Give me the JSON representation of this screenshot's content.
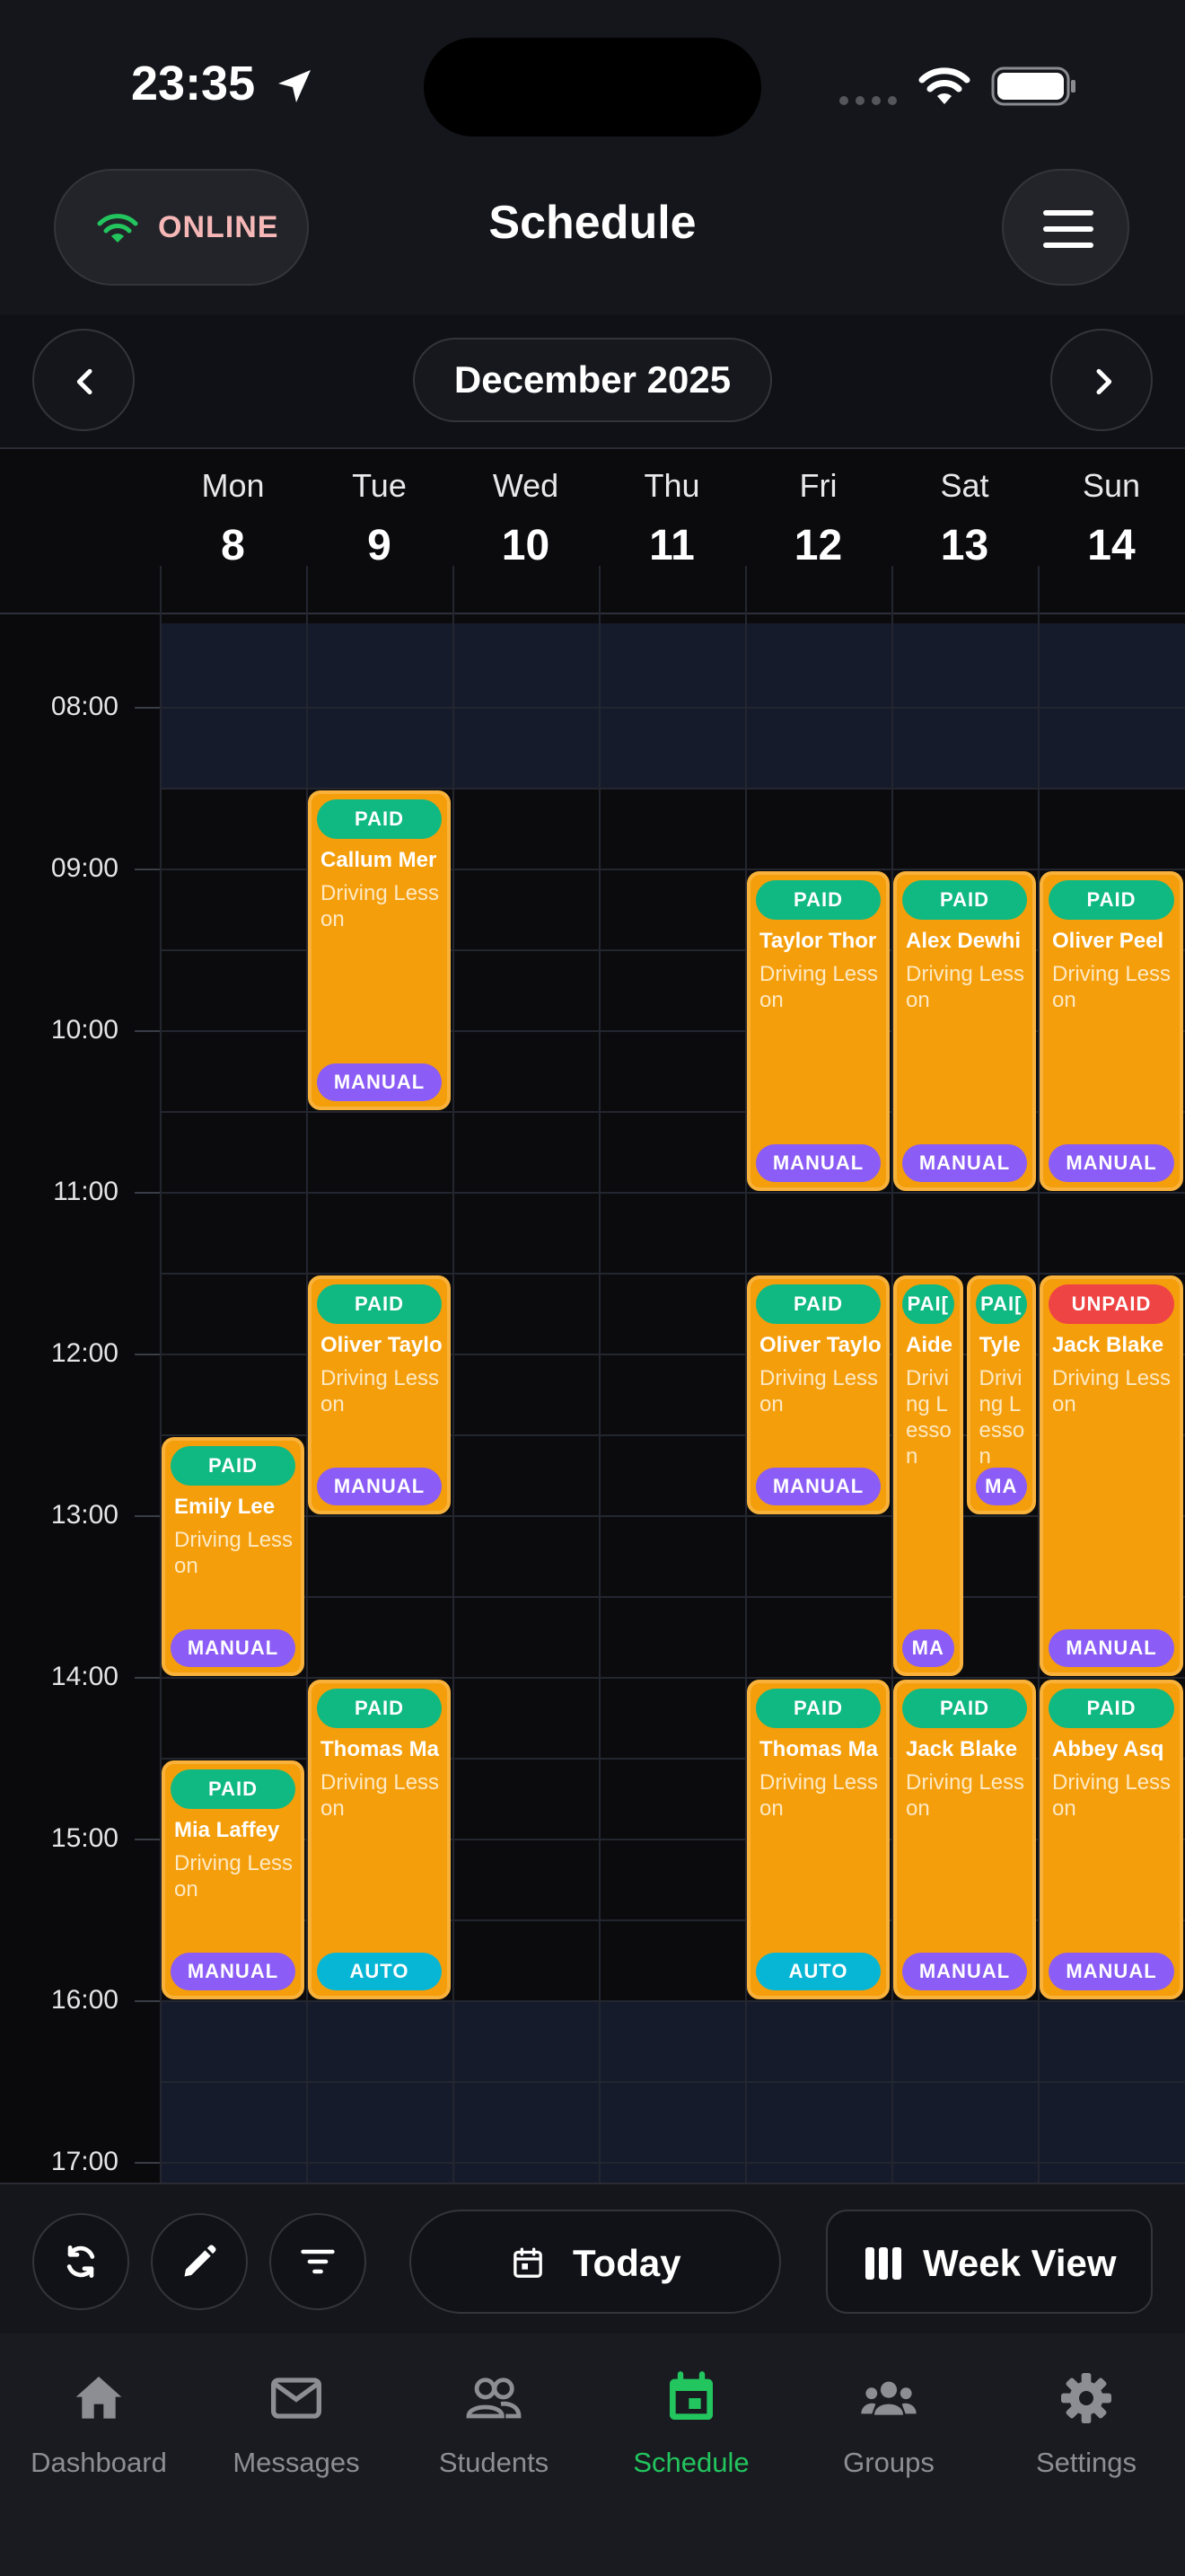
{
  "status_bar": {
    "time": "23:35"
  },
  "header": {
    "connection_status": "ONLINE",
    "title": "Schedule"
  },
  "month_nav": {
    "label": "December 2025"
  },
  "week": {
    "days": [
      {
        "name": "Mon",
        "date": "8"
      },
      {
        "name": "Tue",
        "date": "9"
      },
      {
        "name": "Wed",
        "date": "10"
      },
      {
        "name": "Thu",
        "date": "11"
      },
      {
        "name": "Fri",
        "date": "12"
      },
      {
        "name": "Sat",
        "date": "13"
      },
      {
        "name": "Sun",
        "date": "14"
      }
    ],
    "times": [
      "08:00",
      "09:00",
      "10:00",
      "11:00",
      "12:00",
      "13:00",
      "14:00",
      "15:00",
      "16:00",
      "17:00"
    ]
  },
  "lessons": [
    {
      "day": "Tue",
      "start": "08:30",
      "end": "10:30",
      "payment": "PAID",
      "student": "Callum Mer",
      "title": "Driving Lesson",
      "transmission": "MANUAL"
    },
    {
      "day": "Fri",
      "start": "09:00",
      "end": "11:00",
      "payment": "PAID",
      "student": "Taylor Thor",
      "title": "Driving Lesson",
      "transmission": "MANUAL"
    },
    {
      "day": "Sat",
      "start": "09:00",
      "end": "11:00",
      "payment": "PAID",
      "student": "Alex Dewhi",
      "title": "Driving Lesson",
      "transmission": "MANUAL"
    },
    {
      "day": "Sun",
      "start": "09:00",
      "end": "11:00",
      "payment": "PAID",
      "student": "Oliver Peel",
      "title": "Driving Lesson",
      "transmission": "MANUAL"
    },
    {
      "day": "Tue",
      "start": "11:30",
      "end": "13:00",
      "payment": "PAID",
      "student": "Oliver Taylo",
      "title": "Driving Lesson",
      "transmission": "MANUAL"
    },
    {
      "day": "Fri",
      "start": "11:30",
      "end": "13:00",
      "payment": "PAID",
      "student": "Oliver Taylo",
      "title": "Driving Lesson",
      "transmission": "MANUAL"
    },
    {
      "day": "Sat",
      "start": "11:30",
      "end": "14:00",
      "payment": "PAI[",
      "student": "Aide",
      "title": "Driving Lesson",
      "transmission": "MA"
    },
    {
      "day": "Sat",
      "start": "11:30",
      "end": "13:00",
      "payment": "PAI[",
      "student": "Tyle",
      "title": "Driving Lesson",
      "transmission": "MA"
    },
    {
      "day": "Sun",
      "start": "11:30",
      "end": "14:00",
      "payment": "UNPAID",
      "student": "Jack Blake",
      "title": "Driving Lesson",
      "transmission": "MANUAL"
    },
    {
      "day": "Mon",
      "start": "12:30",
      "end": "14:00",
      "payment": "PAID",
      "student": "Emily Lee",
      "title": "Driving Lesson",
      "transmission": "MANUAL"
    },
    {
      "day": "Tue",
      "start": "14:00",
      "end": "16:00",
      "payment": "PAID",
      "student": "Thomas Ma",
      "title": "Driving Lesson",
      "transmission": "AUTO"
    },
    {
      "day": "Fri",
      "start": "14:00",
      "end": "16:00",
      "payment": "PAID",
      "student": "Thomas Ma",
      "title": "Driving Lesson",
      "transmission": "AUTO"
    },
    {
      "day": "Sat",
      "start": "14:00",
      "end": "16:00",
      "payment": "PAID",
      "student": "Jack Blake",
      "title": "Driving Lesson",
      "transmission": "MANUAL"
    },
    {
      "day": "Sun",
      "start": "14:00",
      "end": "16:00",
      "payment": "PAID",
      "student": "Abbey Asq",
      "title": "Driving Lesson",
      "transmission": "MANUAL"
    },
    {
      "day": "Mon",
      "start": "14:30",
      "end": "16:00",
      "payment": "PAID",
      "student": "Mia Laffey",
      "title": "Driving Lesson",
      "transmission": "MANUAL"
    }
  ],
  "toolbar": {
    "today_label": "Today",
    "view_label": "Week View"
  },
  "bottom_nav": [
    {
      "label": "Dashboard",
      "icon": "home-icon",
      "active": false
    },
    {
      "label": "Messages",
      "icon": "mail-icon",
      "active": false
    },
    {
      "label": "Students",
      "icon": "people-icon",
      "active": false
    },
    {
      "label": "Schedule",
      "icon": "calendar-icon",
      "active": true
    },
    {
      "label": "Groups",
      "icon": "groups-icon",
      "active": false
    },
    {
      "label": "Settings",
      "icon": "gear-icon",
      "active": false
    }
  ],
  "colors": {
    "lesson": "#f59e0b",
    "paid": "#10b981",
    "unpaid": "#ef4444",
    "manual": "#8b5cf6",
    "auto": "#06b6d4",
    "active_nav": "#22c55e",
    "available_band": "#161b2c"
  }
}
